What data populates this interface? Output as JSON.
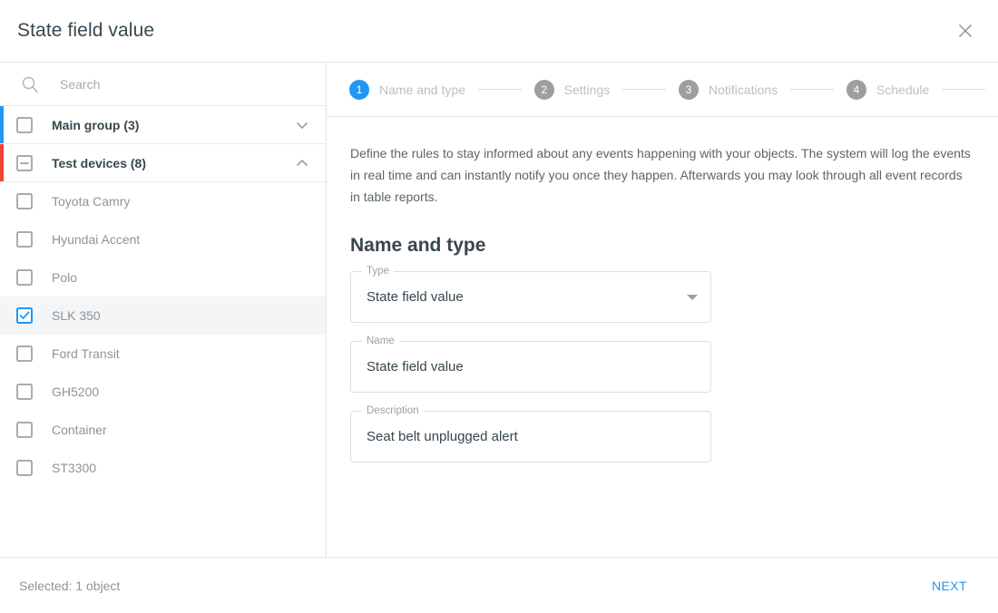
{
  "header": {
    "title": "State field value",
    "close_icon": "close-icon"
  },
  "sidebar": {
    "search": {
      "icon": "search-icon",
      "placeholder": "Search",
      "value": ""
    },
    "groups": [
      {
        "label": "Main group (3)",
        "accent_color": "#2196f3",
        "checkbox_state": "unchecked",
        "expanded": false,
        "chevron": "chevron-down-icon"
      },
      {
        "label": "Test devices (8)",
        "accent_color": "#f44336",
        "checkbox_state": "indeterminate",
        "expanded": true,
        "chevron": "chevron-up-icon"
      }
    ],
    "devices": [
      {
        "label": "Toyota Camry",
        "checked": false
      },
      {
        "label": "Hyundai Accent",
        "checked": false
      },
      {
        "label": "Polo",
        "checked": false
      },
      {
        "label": "SLK 350",
        "checked": true
      },
      {
        "label": "Ford Transit",
        "checked": false
      },
      {
        "label": "GH5200",
        "checked": false
      },
      {
        "label": "Container",
        "checked": false
      },
      {
        "label": "ST3300",
        "checked": false
      }
    ]
  },
  "stepper": {
    "steps": [
      {
        "number": "1",
        "label": "Name and type",
        "active": true
      },
      {
        "number": "2",
        "label": "Settings",
        "active": false
      },
      {
        "number": "3",
        "label": "Notifications",
        "active": false
      },
      {
        "number": "4",
        "label": "Schedule",
        "active": false
      }
    ]
  },
  "main": {
    "intro": "Define the rules to stay informed about any events happening with your objects. The system will log the events in real time and can instantly notify you once they happen. Afterwards you may look through all event records in table reports.",
    "section_title": "Name and type",
    "fields": [
      {
        "label": "Type",
        "value": "State field value",
        "control": "select"
      },
      {
        "label": "Name",
        "value": "State field value",
        "control": "text"
      },
      {
        "label": "Description",
        "value": "Seat belt unplugged alert",
        "control": "text"
      }
    ]
  },
  "footer": {
    "status": "Selected: 1 object",
    "next_label": "NEXT"
  },
  "colors": {
    "accent_blue": "#2196f3",
    "accent_red": "#f44336",
    "step_inactive": "#9e9e9e",
    "divider": "#e4e6e8"
  }
}
